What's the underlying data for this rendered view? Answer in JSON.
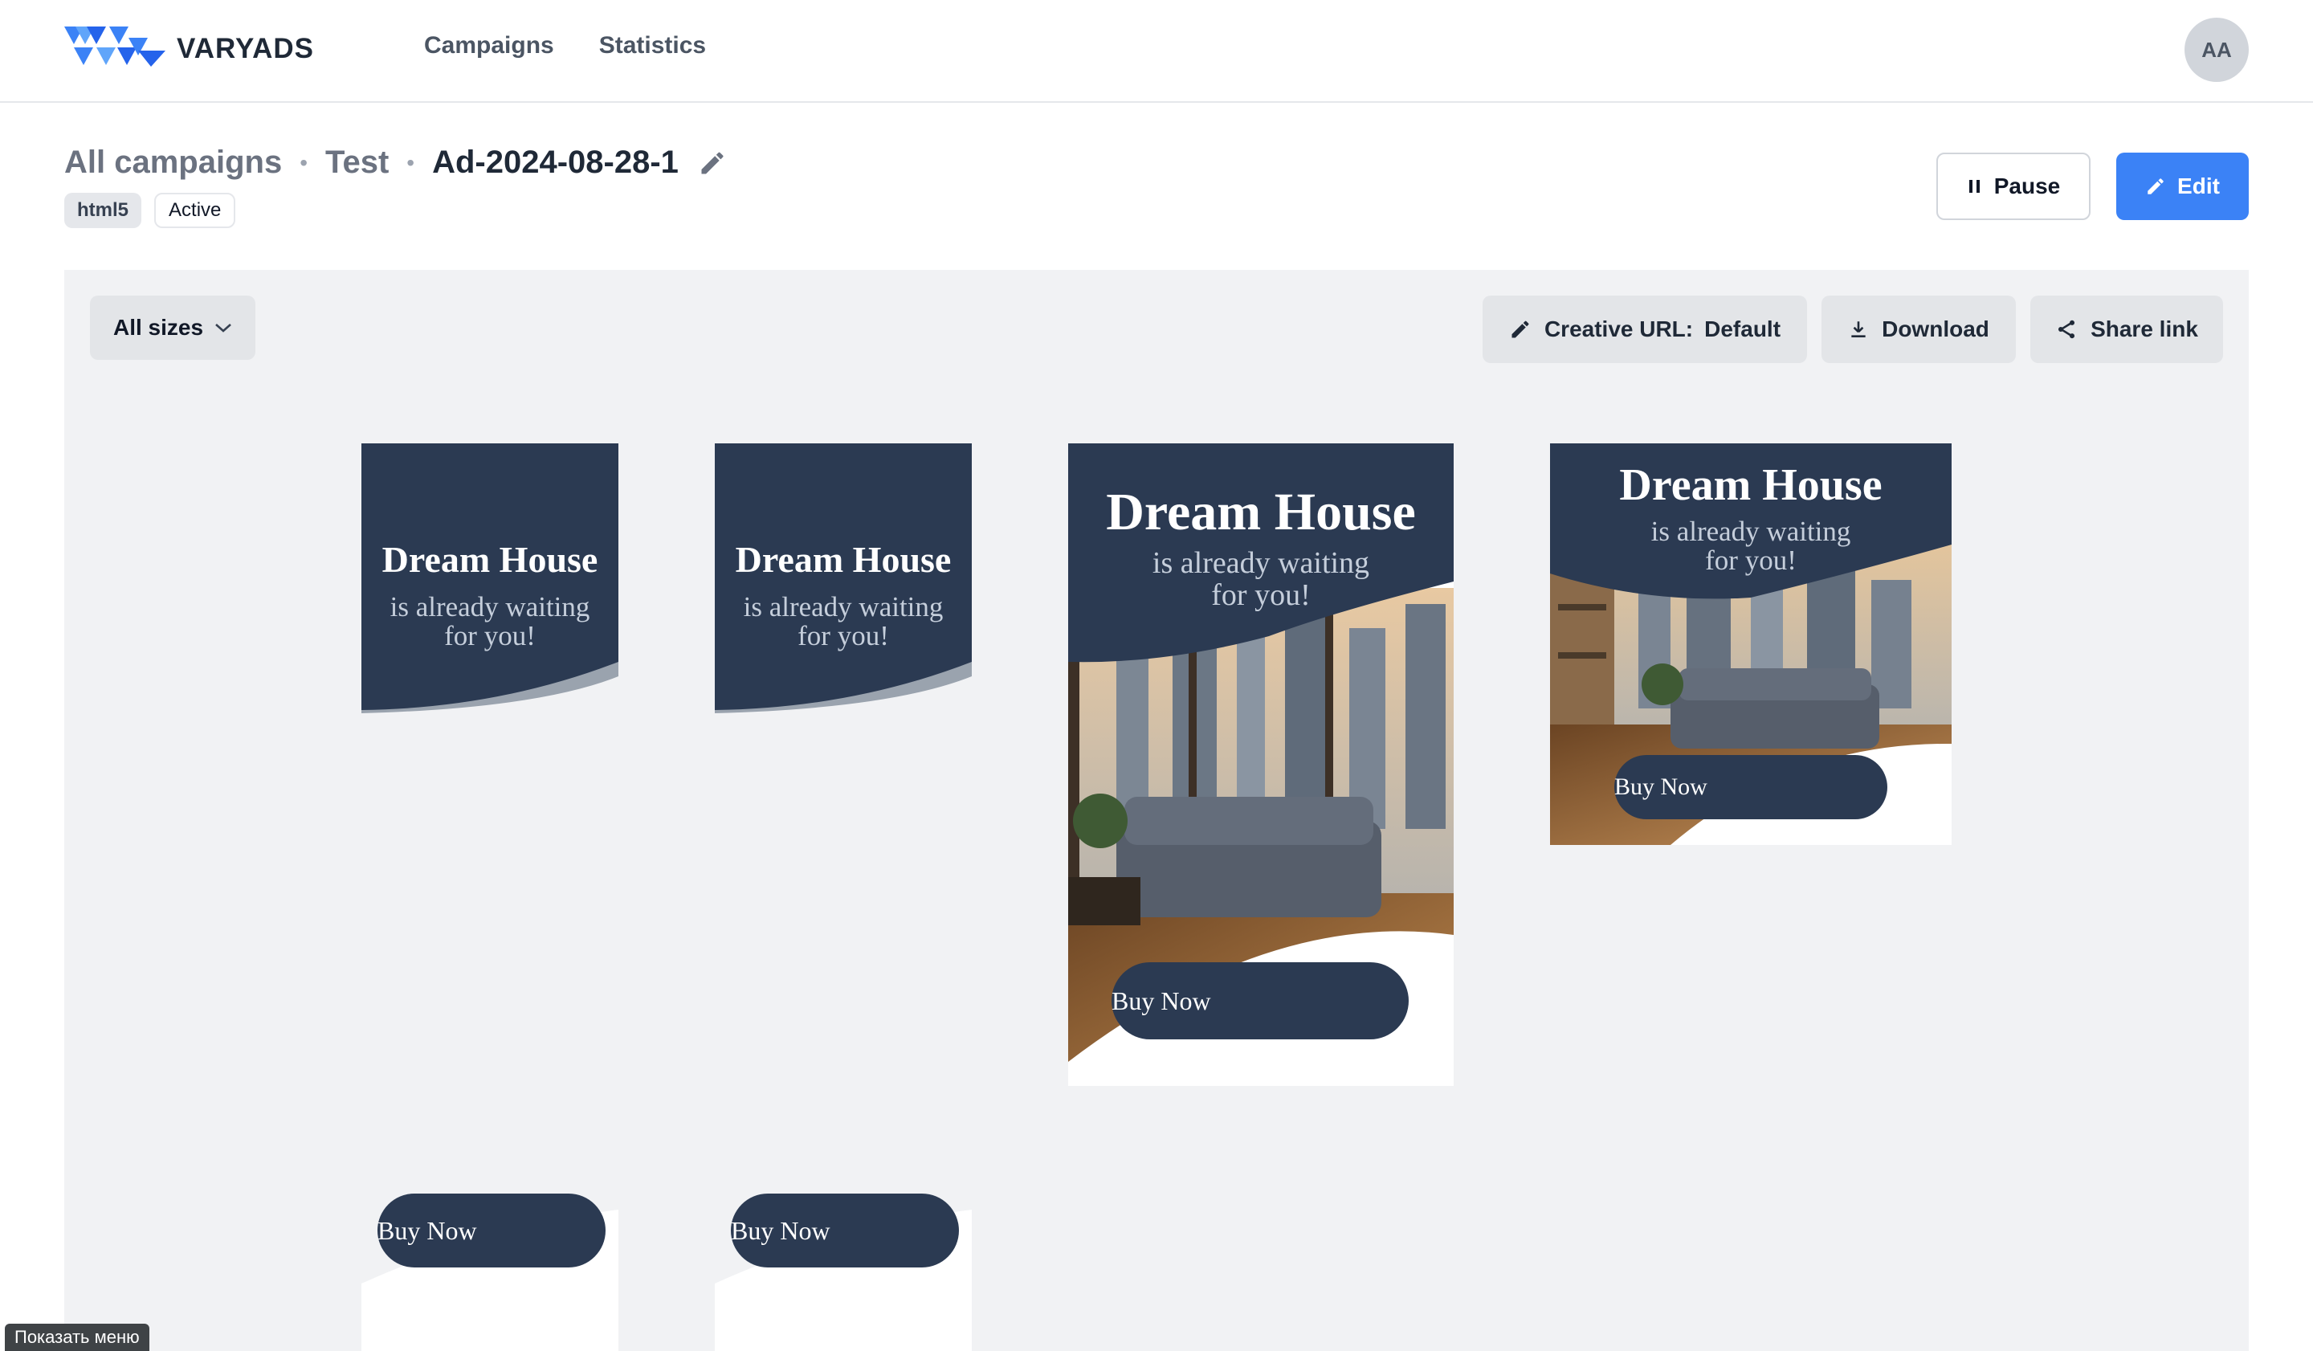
{
  "app": {
    "logo_text": "VARYADS"
  },
  "nav": {
    "items": [
      {
        "label": "Campaigns"
      },
      {
        "label": "Statistics"
      }
    ]
  },
  "user": {
    "initials": "AA"
  },
  "breadcrumb": {
    "root": "All campaigns",
    "campaign": "Test",
    "current": "Ad-2024-08-28-1"
  },
  "badges": {
    "type": "html5",
    "status": "Active"
  },
  "actions": {
    "pause_label": "Pause",
    "edit_label": "Edit"
  },
  "toolbar": {
    "size_select": "All sizes",
    "creative_url_label": "Creative URL:",
    "creative_url_value": "Default",
    "download_label": "Download",
    "share_label": "Share link"
  },
  "ad": {
    "headline": "Dream House",
    "sub_line1": "is already waiting",
    "sub_line2": "for you!",
    "cta": "Buy Now"
  },
  "footer": {
    "menu_toggle": "Показать меню"
  },
  "colors": {
    "accent": "#3b82f6",
    "ad_navy": "#2b3a52",
    "preview_bg": "#f1f2f4"
  }
}
